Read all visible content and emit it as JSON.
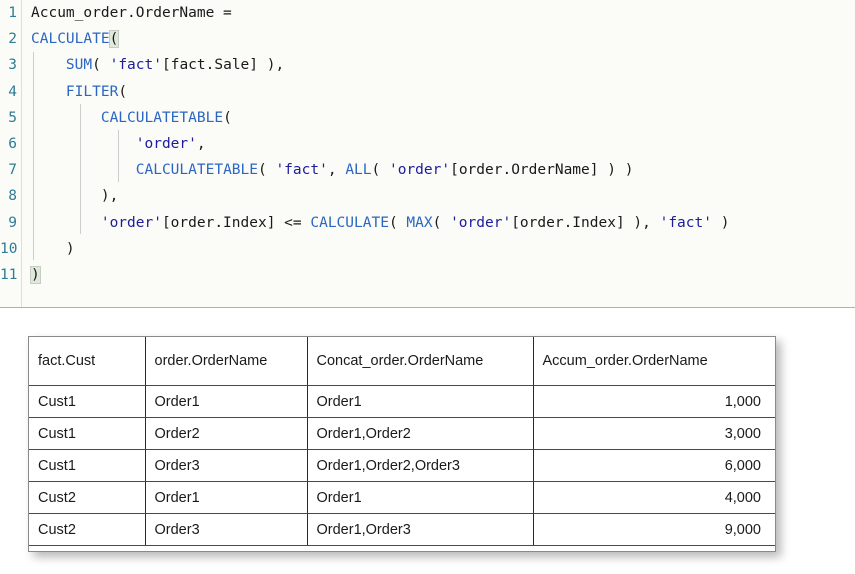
{
  "editor": {
    "name": "dax-formula-editor",
    "gutter_color": "#2e7d95",
    "background": "#fbfbf7",
    "function_color": "#2b66c2",
    "string_color": "#1c1c9c",
    "lines": [
      {
        "number": "1",
        "text": "Accum_order.OrderName ="
      },
      {
        "number": "2",
        "text": "CALCULATE("
      },
      {
        "number": "3",
        "text": "    SUM( 'fact'[fact.Sale] ),"
      },
      {
        "number": "4",
        "text": "    FILTER("
      },
      {
        "number": "5",
        "text": "        CALCULATETABLE("
      },
      {
        "number": "6",
        "text": "            'order',"
      },
      {
        "number": "7",
        "text": "            CALCULATETABLE( 'fact', ALL( 'order'[order.OrderName] ) )"
      },
      {
        "number": "8",
        "text": "        ),"
      },
      {
        "number": "9",
        "text": "        'order'[order.Index] <= CALCULATE( MAX( 'order'[order.Index] ), 'fact' )"
      },
      {
        "number": "10",
        "text": "    )"
      },
      {
        "number": "11",
        "text": ")"
      }
    ]
  },
  "result_table": {
    "name": "result-table",
    "columns": [
      "fact.Cust",
      "order.OrderName",
      "Concat_order.OrderName",
      "Accum_order.OrderName"
    ],
    "rows": [
      {
        "cust": "Cust1",
        "order": "Order1",
        "concat": "Order1",
        "accum": "1,000"
      },
      {
        "cust": "Cust1",
        "order": "Order2",
        "concat": "Order1,Order2",
        "accum": "3,000"
      },
      {
        "cust": "Cust1",
        "order": "Order3",
        "concat": "Order1,Order2,Order3",
        "accum": "6,000"
      },
      {
        "cust": "Cust2",
        "order": "Order1",
        "concat": "Order1",
        "accum": "4,000"
      },
      {
        "cust": "Cust2",
        "order": "Order3",
        "concat": "Order1,Order3",
        "accum": "9,000"
      }
    ]
  }
}
